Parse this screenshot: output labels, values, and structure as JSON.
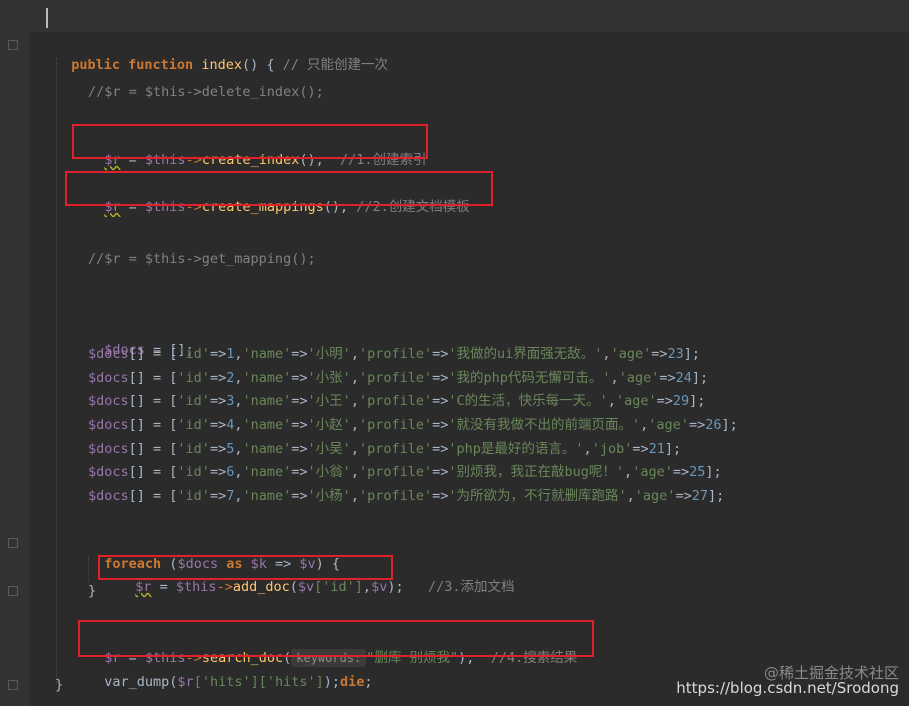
{
  "code": {
    "l_func": {
      "kw": "public function",
      "name": "index",
      "rest": "() {",
      "comment": "// 只能创建一次"
    },
    "l_delete": "//$r = $this->delete_index();",
    "l_create_index": {
      "var": "$r",
      "eq": " = ",
      "this": "$this",
      "arrow": "->",
      "fn": "create_index",
      "rest": "();",
      "comment": "//1.创建索引"
    },
    "l_create_mappings": {
      "var": "$r",
      "eq": " = ",
      "this": "$this",
      "arrow": "->",
      "fn": "create_mappings",
      "rest": "();",
      "comment": "//2.创建文档模板"
    },
    "l_get_mapping": "//$r = $this->get_mapping();",
    "l_docs_init": {
      "var": "$docs",
      "rest": " = [];"
    },
    "docs": [
      {
        "id": "1",
        "name": "小明",
        "key": "'profile'",
        "text": "我做的ui界面强无敌。",
        "agekey": "'age'",
        "age": "23"
      },
      {
        "id": "2",
        "name": "小张",
        "key": "'profile'",
        "text": "我的php代码无懈可击。",
        "agekey": "'age'",
        "age": "24"
      },
      {
        "id": "3",
        "name": "小王",
        "key": "'profile'",
        "text": "C的生活，快乐每一天。",
        "agekey": "'age'",
        "age": "29"
      },
      {
        "id": "4",
        "name": "小赵",
        "key": "'profile'",
        "text": "就没有我做不出的前端页面。",
        "agekey": "'age'",
        "age": "26"
      },
      {
        "id": "5",
        "name": "小吴",
        "key": "'profile'",
        "text": "php是最好的语言。",
        "agekey": "'job'",
        "age": "21"
      },
      {
        "id": "6",
        "name": "小翁",
        "key": "'profile'",
        "text": "别烦我，我正在敲bug呢！",
        "agekey": "'age'",
        "age": "25"
      },
      {
        "id": "7",
        "name": "小杨",
        "key": "'profile'",
        "text": "为所欲为，不行就删库跑路",
        "agekey": "'age'",
        "age": "27"
      }
    ],
    "l_foreach": {
      "kw": "foreach",
      "open": " (",
      "docs": "$docs",
      "as": " as ",
      "k": "$k",
      "arrow": " => ",
      "v": "$v",
      "close": ") {"
    },
    "l_add_doc": {
      "var": "$r",
      "eq": " = ",
      "this": "$this",
      "arrow": "->",
      "fn": "add_doc",
      "p1": "(",
      "v1": "$v",
      "idx": "['id']",
      "comma": ",",
      "v2": "$v",
      "close": ");",
      "comment": "//3.添加文档"
    },
    "l_close_brace": "}",
    "l_search": {
      "var": "$r",
      "eq": " = ",
      "this": "$this",
      "arrow": "->",
      "fn": "search_doc",
      "p1": "(",
      "hint": "keywords:",
      "str": "\"删库 别烦我\"",
      "close": ");",
      "comment": "//4.搜索结果"
    },
    "l_dump": {
      "fn": "var_dump(",
      "var": "$r",
      "idx": "['hits']['hits']",
      "close": ");",
      "die": "die",
      "semi": ";"
    },
    "l_end": "}"
  },
  "watermark": {
    "top": "@稀土掘金技术社区",
    "bottom": "https://blog.csdn.net/Srodong"
  }
}
